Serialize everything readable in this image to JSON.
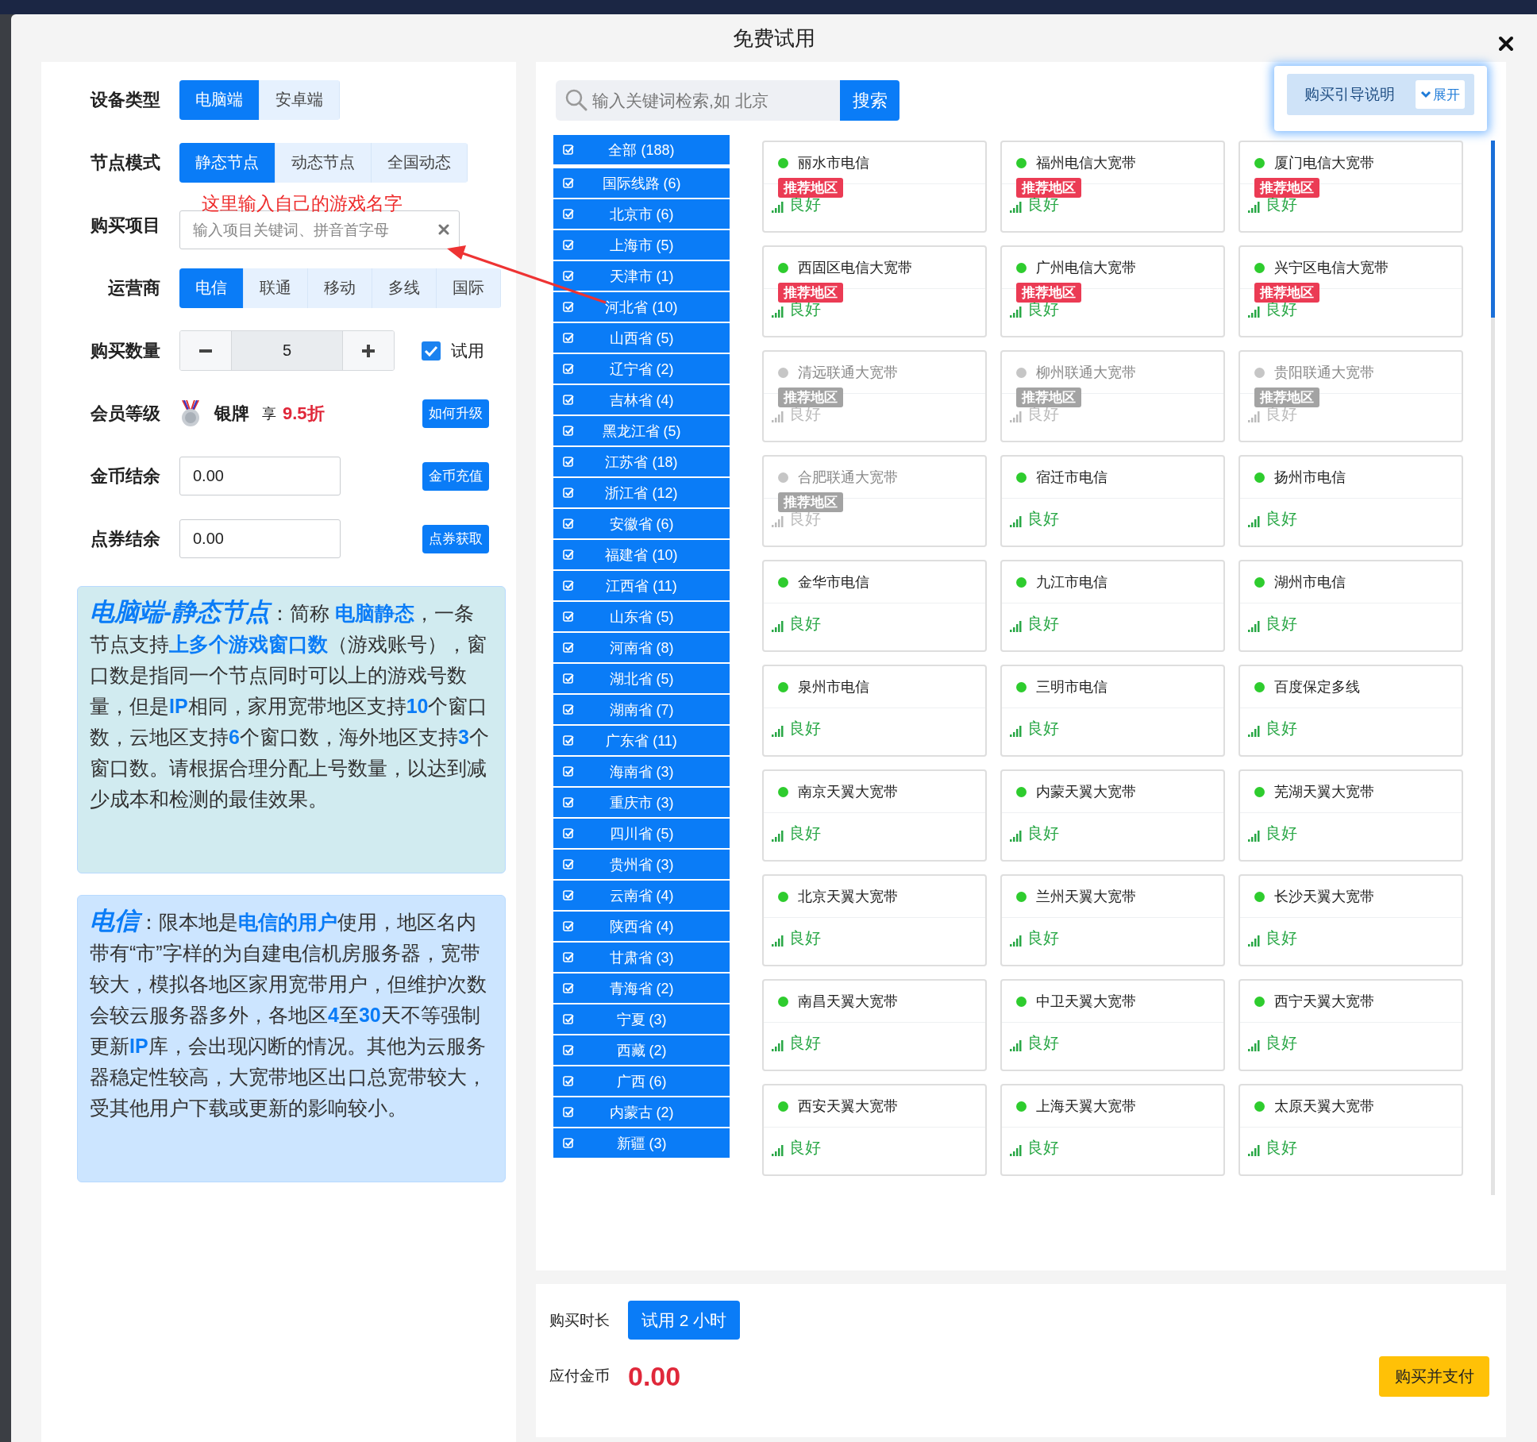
{
  "dialog": {
    "title": "免费试用"
  },
  "form": {
    "device_type": {
      "label": "设备类型",
      "options": [
        {
          "label": "电脑端",
          "selected": true
        },
        {
          "label": "安卓端",
          "selected": false
        }
      ]
    },
    "node_mode": {
      "label": "节点模式",
      "options": [
        {
          "label": "静态节点",
          "selected": true
        },
        {
          "label": "动态节点",
          "selected": false
        },
        {
          "label": "全国动态",
          "selected": false
        }
      ]
    },
    "project": {
      "label": "购买项目",
      "placeholder": "输入项目关键词、拼音首字母",
      "annotation": "这里输入自己的游戏名字"
    },
    "carrier": {
      "label": "运营商",
      "options": [
        {
          "label": "电信",
          "selected": true
        },
        {
          "label": "联通",
          "selected": false
        },
        {
          "label": "移动",
          "selected": false
        },
        {
          "label": "多线",
          "selected": false
        },
        {
          "label": "国际",
          "selected": false
        }
      ]
    },
    "quantity": {
      "label": "购买数量",
      "value": "5",
      "trial": {
        "label": "试用",
        "checked": true
      }
    },
    "member": {
      "label": "会员等级",
      "level": "银牌",
      "prefix": "享",
      "discount": "9.5折",
      "button": "如何升级"
    },
    "coins": {
      "label": "金币结余",
      "value": "0.00",
      "button": "金币充值"
    },
    "vouchers": {
      "label": "点券结余",
      "value": "0.00",
      "button": "点券获取"
    }
  },
  "notes": [
    {
      "title": "电脑端-静态节点",
      "color": "#d1ebf0",
      "text": "：简称 **电脑静态**，一条节点支持**上多个游戏窗口数**（游戏账号），窗口数是指同一个节点同时可以上的游戏号数量，但是**IP**相同，家用宽带地区支持**10**个窗口数，云地区支持**6**个窗口数，海外地区支持**3**个窗口数。请根据合理分配上号数量，以达到减少成本和检测的最佳效果。"
    },
    {
      "title": "电信",
      "color": "#cce5ff",
      "text": "：限本地是**电信的用户**使用，地区名内带有“市”字样的为自建电信机房服务器，宽带较大，模拟各地区家用宽带用户，但维护次数会较云服务器多外，各地区**4**至**30**天不等强制更新**IP**库，会出现闪断的情况。其他为云服务器稳定性较高，大宽带地区出口总宽带较大，受其他用户下载或更新的影响较小。"
    }
  ],
  "search": {
    "placeholder": "输入关键词检索,如 北京",
    "button": "搜索"
  },
  "guide": {
    "label": "购买引导说明",
    "button": "展开"
  },
  "regions": [
    {
      "label": "全部 (188)",
      "checked": true
    },
    {
      "label": "国际线路 (6)",
      "checked": true
    },
    {
      "label": "北京市 (6)",
      "checked": true
    },
    {
      "label": "上海市 (5)",
      "checked": true
    },
    {
      "label": "天津市 (1)",
      "checked": true
    },
    {
      "label": "河北省 (10)",
      "checked": true
    },
    {
      "label": "山西省 (5)",
      "checked": true
    },
    {
      "label": "辽宁省 (2)",
      "checked": true
    },
    {
      "label": "吉林省 (4)",
      "checked": true
    },
    {
      "label": "黑龙江省 (5)",
      "checked": true
    },
    {
      "label": "江苏省 (18)",
      "checked": true
    },
    {
      "label": "浙江省 (12)",
      "checked": true
    },
    {
      "label": "安徽省 (6)",
      "checked": true
    },
    {
      "label": "福建省 (10)",
      "checked": true
    },
    {
      "label": "江西省 (11)",
      "checked": true
    },
    {
      "label": "山东省 (5)",
      "checked": true
    },
    {
      "label": "河南省 (8)",
      "checked": true
    },
    {
      "label": "湖北省 (5)",
      "checked": true
    },
    {
      "label": "湖南省 (7)",
      "checked": true
    },
    {
      "label": "广东省 (11)",
      "checked": true
    },
    {
      "label": "海南省 (3)",
      "checked": true
    },
    {
      "label": "重庆市 (3)",
      "checked": true
    },
    {
      "label": "四川省 (5)",
      "checked": true
    },
    {
      "label": "贵州省 (3)",
      "checked": true
    },
    {
      "label": "云南省 (4)",
      "checked": true
    },
    {
      "label": "陕西省 (4)",
      "checked": true
    },
    {
      "label": "甘肃省 (3)",
      "checked": true
    },
    {
      "label": "青海省 (2)",
      "checked": true
    },
    {
      "label": "宁夏 (3)",
      "checked": true
    },
    {
      "label": "西藏 (2)",
      "checked": true
    },
    {
      "label": "广西 (6)",
      "checked": true
    },
    {
      "label": "内蒙古 (2)",
      "checked": true
    },
    {
      "label": "新疆 (3)",
      "checked": true
    }
  ],
  "nodes": [
    {
      "name": "丽水市电信",
      "online": true,
      "badge": "推荐地区",
      "signal": "良好"
    },
    {
      "name": "福州电信大宽带",
      "online": true,
      "badge": "推荐地区",
      "signal": "良好"
    },
    {
      "name": "厦门电信大宽带",
      "online": true,
      "badge": "推荐地区",
      "signal": "良好"
    },
    {
      "name": "西固区电信大宽带",
      "online": true,
      "badge": "推荐地区",
      "signal": "良好"
    },
    {
      "name": "广州电信大宽带",
      "online": true,
      "badge": "推荐地区",
      "signal": "良好"
    },
    {
      "name": "兴宁区电信大宽带",
      "online": true,
      "badge": "推荐地区",
      "signal": "良好"
    },
    {
      "name": "清远联通大宽带",
      "online": false,
      "badge": "推荐地区",
      "signal": "良好"
    },
    {
      "name": "柳州联通大宽带",
      "online": false,
      "badge": "推荐地区",
      "signal": "良好"
    },
    {
      "name": "贵阳联通大宽带",
      "online": false,
      "badge": "推荐地区",
      "signal": "良好"
    },
    {
      "name": "合肥联通大宽带",
      "online": false,
      "badge": "推荐地区",
      "signal": "良好"
    },
    {
      "name": "宿迁市电信",
      "online": true,
      "signal": "良好"
    },
    {
      "name": "扬州市电信",
      "online": true,
      "signal": "良好"
    },
    {
      "name": "金华市电信",
      "online": true,
      "signal": "良好"
    },
    {
      "name": "九江市电信",
      "online": true,
      "signal": "良好"
    },
    {
      "name": "湖州市电信",
      "online": true,
      "signal": "良好"
    },
    {
      "name": "泉州市电信",
      "online": true,
      "signal": "良好"
    },
    {
      "name": "三明市电信",
      "online": true,
      "signal": "良好"
    },
    {
      "name": "百度保定多线",
      "online": true,
      "signal": "良好"
    },
    {
      "name": "南京天翼大宽带",
      "online": true,
      "signal": "良好"
    },
    {
      "name": "内蒙天翼大宽带",
      "online": true,
      "signal": "良好"
    },
    {
      "name": "芜湖天翼大宽带",
      "online": true,
      "signal": "良好"
    },
    {
      "name": "北京天翼大宽带",
      "online": true,
      "signal": "良好"
    },
    {
      "name": "兰州天翼大宽带",
      "online": true,
      "signal": "良好"
    },
    {
      "name": "长沙天翼大宽带",
      "online": true,
      "signal": "良好"
    },
    {
      "name": "南昌天翼大宽带",
      "online": true,
      "signal": "良好"
    },
    {
      "name": "中卫天翼大宽带",
      "online": true,
      "signal": "良好"
    },
    {
      "name": "西宁天翼大宽带",
      "online": true,
      "signal": "良好"
    },
    {
      "name": "西安天翼大宽带",
      "online": true,
      "signal": "良好"
    },
    {
      "name": "上海天翼大宽带",
      "online": true,
      "signal": "良好"
    },
    {
      "name": "太原天翼大宽带",
      "online": true,
      "signal": "良好"
    }
  ],
  "footer": {
    "duration_label": "购买时长",
    "duration_button": "试用 2 小时",
    "amount_label": "应付金币",
    "amount": "0.00",
    "pay_button": "购买并支付"
  }
}
